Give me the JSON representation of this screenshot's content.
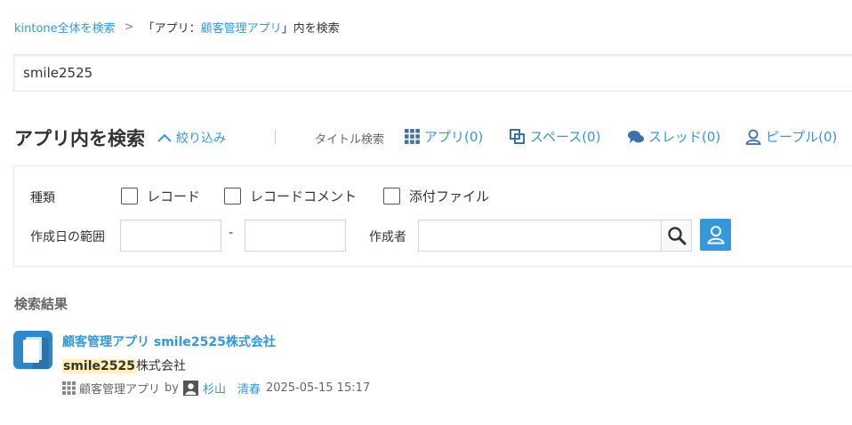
{
  "breadcrumb": {
    "root": "kintone全体を検索",
    "separator": ">",
    "prefix": "「アプリ：",
    "app_name": "顧客管理アプリ",
    "suffix": "」内を検索"
  },
  "search": {
    "value": "smile2525",
    "placeholder": ""
  },
  "header": {
    "title": "アプリ内を検索",
    "filter_toggle": "絞り込み",
    "title_search_label": "タイトル検索",
    "tabs": [
      {
        "label": "アプリ(0)",
        "icon": "grid-icon"
      },
      {
        "label": "スペース(0)",
        "icon": "space-icon"
      },
      {
        "label": "スレッド(0)",
        "icon": "thread-icon"
      },
      {
        "label": "ピープル(0)",
        "icon": "people-icon"
      }
    ]
  },
  "filter": {
    "type_label": "種類",
    "types": [
      "レコード",
      "レコードコメント",
      "添付ファイル"
    ],
    "date_label": "作成日の範囲",
    "date_sep": "-",
    "creator_label": "作成者",
    "date_from": "",
    "date_to": "",
    "creator_value": ""
  },
  "results": {
    "heading": "検索結果",
    "items": [
      {
        "title": "顧客管理アプリ smile2525株式会社",
        "snippet_highlight": "smile2525",
        "snippet_rest": "株式会社",
        "app": "顧客管理アプリ",
        "by": "by",
        "user": "杉山　清春",
        "timestamp": "2025-05-15 15:17"
      }
    ]
  },
  "colors": {
    "link": "#3498db",
    "accent_button": "#3498db",
    "highlight": "#fff1b3",
    "record_icon": "#2f86c8"
  }
}
